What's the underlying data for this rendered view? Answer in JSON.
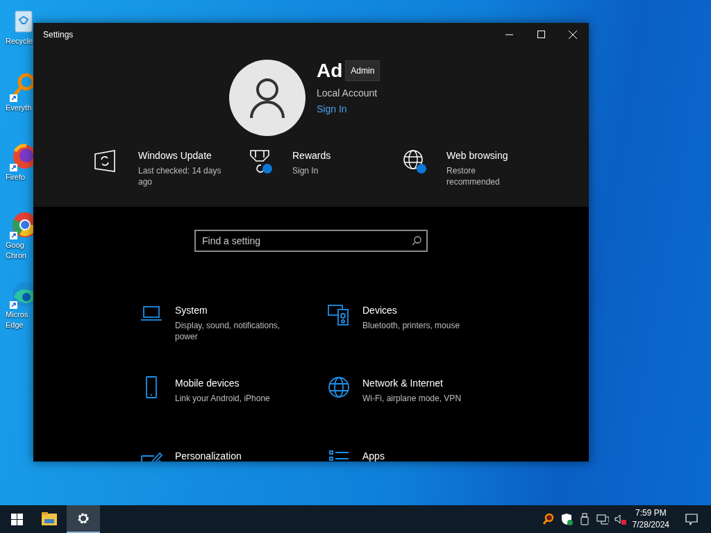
{
  "desktop_icons": [
    {
      "kind": "recycle",
      "lines": [
        "Recycle"
      ]
    },
    {
      "kind": "everything",
      "lines": [
        "Everyth"
      ]
    },
    {
      "kind": "firefox",
      "lines": [
        "Firefo"
      ]
    },
    {
      "kind": "chrome",
      "lines": [
        "Goog",
        "Chron"
      ]
    },
    {
      "kind": "edge",
      "lines": [
        "Micros",
        "Edge"
      ]
    }
  ],
  "window": {
    "title": "Settings"
  },
  "profile": {
    "name": "Ad",
    "tooltip": "Admin",
    "account_type": "Local Account",
    "sign_in_link": "Sign In"
  },
  "status_items": [
    {
      "kind": "update",
      "title": "Windows Update",
      "subtitle": "Last checked: 14 days ago",
      "badge": false
    },
    {
      "kind": "rewards",
      "title": "Rewards",
      "subtitle": "Sign In",
      "badge": true
    },
    {
      "kind": "web",
      "title": "Web browsing",
      "subtitle": "Restore recommended",
      "badge": true
    }
  ],
  "search": {
    "placeholder": "Find a setting"
  },
  "categories": [
    {
      "kind": "system",
      "title": "System",
      "subtitle": "Display, sound, notifications, power"
    },
    {
      "kind": "devices",
      "title": "Devices",
      "subtitle": "Bluetooth, printers, mouse"
    },
    {
      "kind": "mobile",
      "title": "Mobile devices",
      "subtitle": "Link your Android, iPhone"
    },
    {
      "kind": "network",
      "title": "Network & Internet",
      "subtitle": "Wi-Fi, airplane mode, VPN"
    },
    {
      "kind": "personalization",
      "title": "Personalization"
    },
    {
      "kind": "apps",
      "title": "Apps"
    }
  ],
  "taskbar": {
    "apps": [
      {
        "kind": "explorer",
        "selected": false
      },
      {
        "kind": "settings",
        "selected": true
      }
    ],
    "tray": [
      {
        "kind": "search-tool"
      },
      {
        "kind": "shield"
      },
      {
        "kind": "usb"
      },
      {
        "kind": "network"
      },
      {
        "kind": "volume-muted"
      }
    ],
    "clock": {
      "time": "7:59 PM",
      "date": "7/28/2024"
    }
  }
}
